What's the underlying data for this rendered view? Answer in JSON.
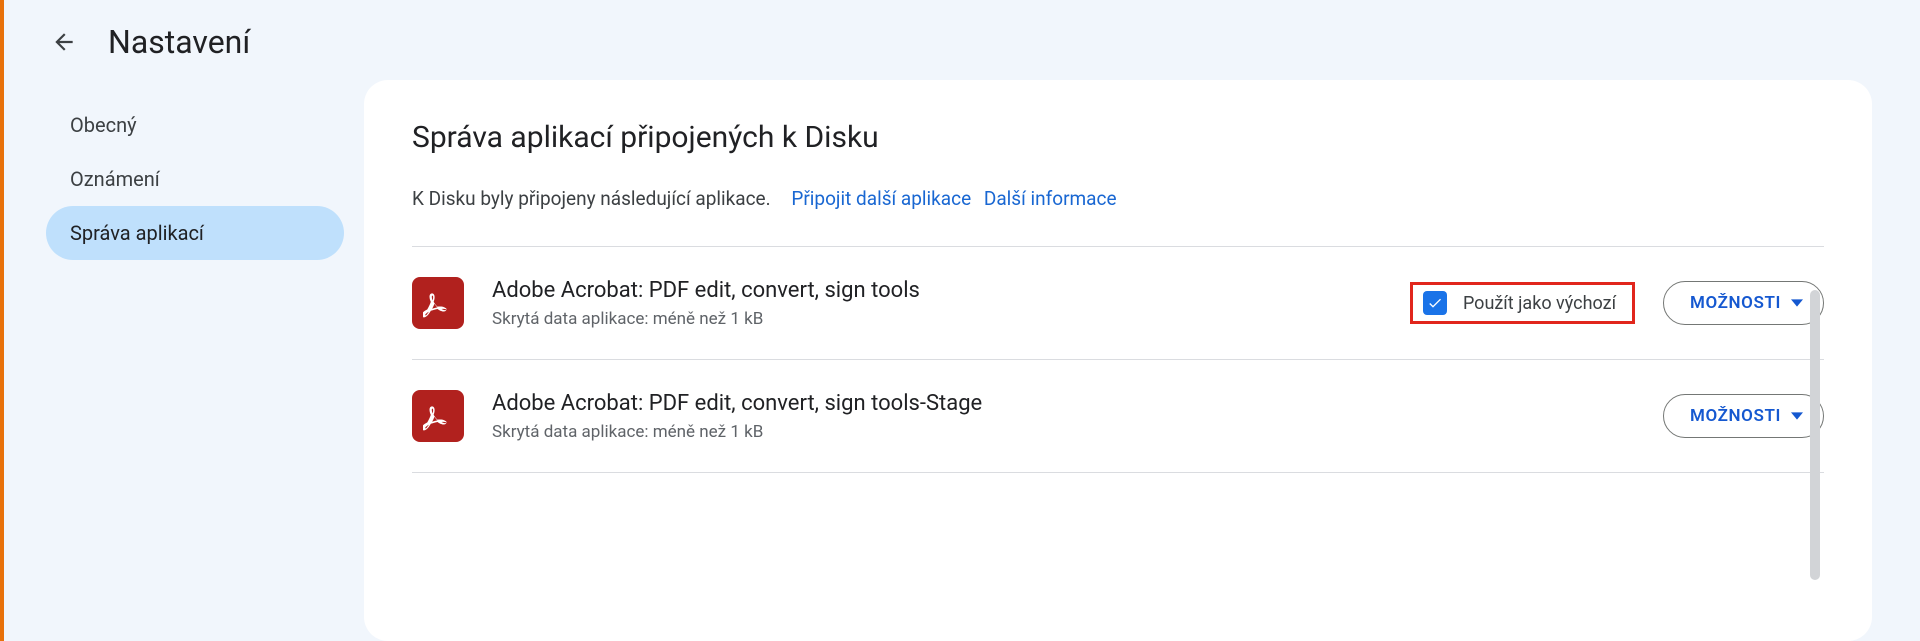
{
  "header": {
    "title": "Nastavení"
  },
  "sidebar": {
    "items": [
      {
        "label": "Obecný",
        "selected": false
      },
      {
        "label": "Oznámení",
        "selected": false
      },
      {
        "label": "Správa aplikací",
        "selected": true
      }
    ]
  },
  "main": {
    "title": "Správa aplikací připojených k Disku",
    "intro_text": "K Disku byly připojeny následující aplikace.",
    "link_connect": "Připojit další aplikace",
    "link_more": "Další informace",
    "options_label": "MOŽNOSTI",
    "default_label": "Použít jako výchozí",
    "apps": [
      {
        "name": "Adobe Acrobat: PDF edit, convert, sign tools",
        "subtitle": "Skrytá data aplikace: méně než 1 kB",
        "icon": "acrobat-icon",
        "show_default": true,
        "default_checked": true,
        "highlight_default": true
      },
      {
        "name": "Adobe Acrobat: PDF edit, convert, sign tools-Stage",
        "subtitle": "Skrytá data aplikace: méně než 1 kB",
        "icon": "acrobat-icon",
        "show_default": false,
        "default_checked": false,
        "highlight_default": false
      }
    ]
  }
}
